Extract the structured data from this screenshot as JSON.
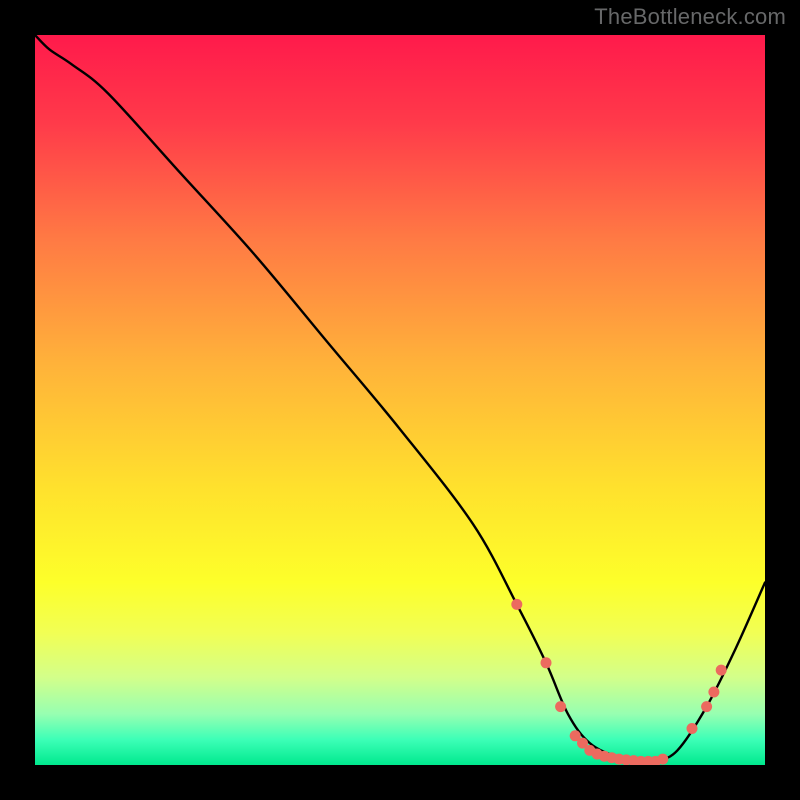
{
  "attribution": "TheBottleneck.com",
  "chart_data": {
    "type": "line",
    "title": "",
    "xlabel": "",
    "ylabel": "",
    "xlim": [
      0,
      100
    ],
    "ylim": [
      0,
      100
    ],
    "series": [
      {
        "name": "bottleneck-curve",
        "x": [
          0,
          2,
          5,
          10,
          20,
          30,
          40,
          50,
          60,
          66,
          70,
          73,
          76,
          80,
          83,
          85,
          88,
          92,
          96,
          100
        ],
        "y": [
          100,
          98,
          96,
          92,
          81,
          70,
          58,
          46,
          33,
          22,
          14,
          7,
          3,
          1,
          0.5,
          0.5,
          2,
          8,
          16,
          25
        ]
      }
    ],
    "markers": {
      "name": "highlight-points",
      "color": "#ec6a5f",
      "x": [
        66,
        70,
        72,
        74,
        75,
        76,
        77,
        78,
        79,
        80,
        81,
        82,
        83,
        84,
        85,
        86,
        90,
        92,
        93,
        94
      ],
      "y": [
        22,
        14,
        8,
        4,
        3,
        2,
        1.5,
        1.2,
        1,
        0.8,
        0.7,
        0.6,
        0.5,
        0.5,
        0.5,
        0.8,
        5,
        8,
        10,
        13
      ]
    },
    "background": {
      "type": "vertical-gradient",
      "stops": [
        {
          "pos": 0.0,
          "color": "#ff1a4b"
        },
        {
          "pos": 0.12,
          "color": "#ff3a4a"
        },
        {
          "pos": 0.28,
          "color": "#ff7a44"
        },
        {
          "pos": 0.45,
          "color": "#ffb23a"
        },
        {
          "pos": 0.62,
          "color": "#ffe12d"
        },
        {
          "pos": 0.75,
          "color": "#fdff2a"
        },
        {
          "pos": 0.82,
          "color": "#f1ff55"
        },
        {
          "pos": 0.88,
          "color": "#d3ff8a"
        },
        {
          "pos": 0.93,
          "color": "#97ffb1"
        },
        {
          "pos": 0.965,
          "color": "#3dffb7"
        },
        {
          "pos": 1.0,
          "color": "#00e98e"
        }
      ]
    }
  }
}
